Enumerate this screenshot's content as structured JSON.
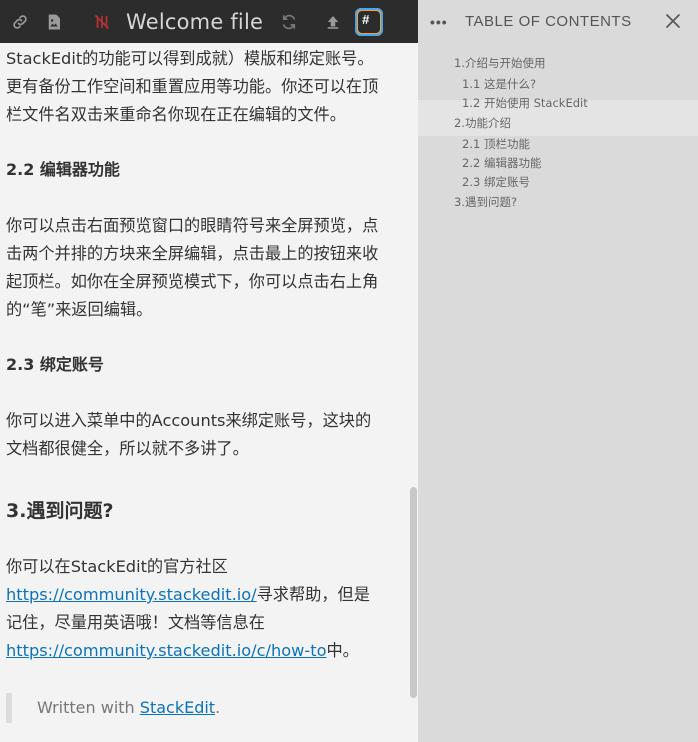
{
  "navbar": {
    "title": "Welcome file",
    "icons": [
      "link-icon",
      "image-icon",
      "sync-disabled-icon",
      "sync-icon",
      "upload-icon",
      "toc-toggle-icon"
    ],
    "toc_toggle_glyph": "#"
  },
  "preview": {
    "para_1": "StackEdit的功能可以得到成就）模版和绑定账号。更有备份工作空间和重置应用等功能。你还可以在顶栏文件名双击来重命名你现在正在编辑的文件。",
    "h_2_2": "2.2 编辑器功能",
    "para_2": "你可以点击右面预览窗口的眼睛符号来全屏预览，点击两个并排的方块来全屏编辑，点击最上的按钮来收起顶栏。如你在全屏预览模式下，你可以点击右上角的“笔”来返回编辑。",
    "h_2_3": "2.3 绑定账号",
    "para_3": "你可以进入菜单中的Accounts来绑定账号，这块的文档都很健全，所以就不多讲了。",
    "h_3": "3.遇到问题?",
    "para_4_a": "你可以在StackEdit的官方社区",
    "link_1": "https://community.stackedit.io/",
    "para_4_b": "寻求帮助，但是记住，尽量用英语哦！文档等信息在",
    "link_2": "https://community.stackedit.io/c/how-to",
    "para_4_c": "中。",
    "quote_prefix": "Written with ",
    "quote_link": "StackEdit",
    "quote_suffix": "."
  },
  "toc": {
    "menu_glyph": "•••",
    "title": "TABLE OF CONTENTS",
    "items": [
      {
        "label": "1.介绍与开始使用",
        "level": 1
      },
      {
        "label": "1.1 这是什么?",
        "level": 2
      },
      {
        "label": "1.2 开始使用 StackEdit",
        "level": 2
      },
      {
        "label": "2.功能介绍",
        "level": 1
      },
      {
        "label": "2.1 顶栏功能",
        "level": 2
      },
      {
        "label": "2.2 编辑器功能",
        "level": 2
      },
      {
        "label": "2.3 绑定账号",
        "level": 2
      },
      {
        "label": "3.遇到问题?",
        "level": 1
      }
    ]
  },
  "colors": {
    "navbar_bg": "#2c2c2c",
    "preview_bg": "#f3f3f3",
    "toc_bg": "#dadada",
    "link": "#0c73b8",
    "toc_toggle_accent": "#f0a532"
  }
}
